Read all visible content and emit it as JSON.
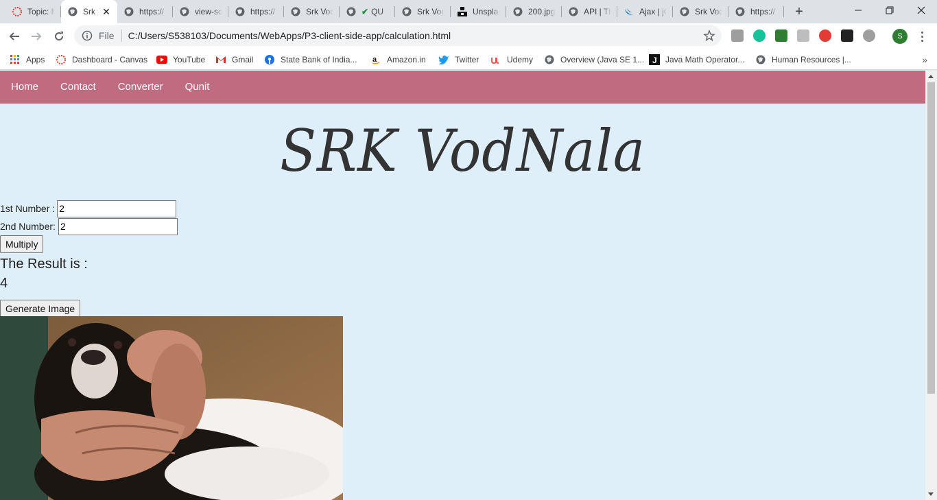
{
  "browser": {
    "tabs": [
      {
        "title": "Topic: M",
        "icon": "canvas-icon",
        "active": false
      },
      {
        "title": "Srk",
        "icon": "globe-icon",
        "active": true
      },
      {
        "title": "https://",
        "icon": "globe-icon",
        "active": false
      },
      {
        "title": "view-so",
        "icon": "globe-icon",
        "active": false
      },
      {
        "title": "https://",
        "icon": "globe-icon",
        "active": false
      },
      {
        "title": "Srk Vod",
        "icon": "globe-icon",
        "active": false
      },
      {
        "title": "QU",
        "icon": "checkmark-icon",
        "active": false
      },
      {
        "title": "Srk Vod",
        "icon": "globe-icon",
        "active": false
      },
      {
        "title": "Unsplas",
        "icon": "unsplash-icon",
        "active": false
      },
      {
        "title": "200.jpg",
        "icon": "globe-icon",
        "active": false
      },
      {
        "title": "API | Th",
        "icon": "globe-icon",
        "active": false
      },
      {
        "title": "Ajax | jC",
        "icon": "jquery-icon",
        "active": false
      },
      {
        "title": "Srk Vod",
        "icon": "globe-icon",
        "active": false
      },
      {
        "title": "https://",
        "icon": "globe-icon",
        "active": false
      }
    ],
    "address": {
      "scheme": "File",
      "url": "C:/Users/S538103/Documents/WebApps/P3-client-side-app/calculation.html"
    },
    "profile_initial": "S",
    "bookmarks": [
      {
        "label": "Apps",
        "icon": "apps-grid-icon"
      },
      {
        "label": "Dashboard - Canvas",
        "icon": "canvas-icon"
      },
      {
        "label": "YouTube",
        "icon": "youtube-icon"
      },
      {
        "label": "Gmail",
        "icon": "gmail-icon"
      },
      {
        "label": "State Bank of India...",
        "icon": "sbi-icon"
      },
      {
        "label": "Amazon.in",
        "icon": "amazon-icon"
      },
      {
        "label": "Twitter",
        "icon": "twitter-icon"
      },
      {
        "label": "Udemy",
        "icon": "udemy-icon"
      },
      {
        "label": "Overview (Java SE 1...",
        "icon": "globe-icon"
      },
      {
        "label": "Java Math Operator...",
        "icon": "j-icon"
      },
      {
        "label": "Human Resources |...",
        "icon": "globe-icon"
      }
    ]
  },
  "site": {
    "nav": [
      "Home",
      "Contact",
      "Converter",
      "Qunit"
    ],
    "title": "SRK VodNala",
    "colors": {
      "nav_bg": "#c16b80",
      "page_bg": "#dfeffa"
    }
  },
  "calculator": {
    "first_label": "1st Number :",
    "first_value": "2",
    "second_label": "2nd Number:",
    "second_value": "2",
    "multiply_label": "Multiply",
    "result_label": "The Result is :",
    "result_value": "4",
    "generate_label": "Generate Image"
  }
}
